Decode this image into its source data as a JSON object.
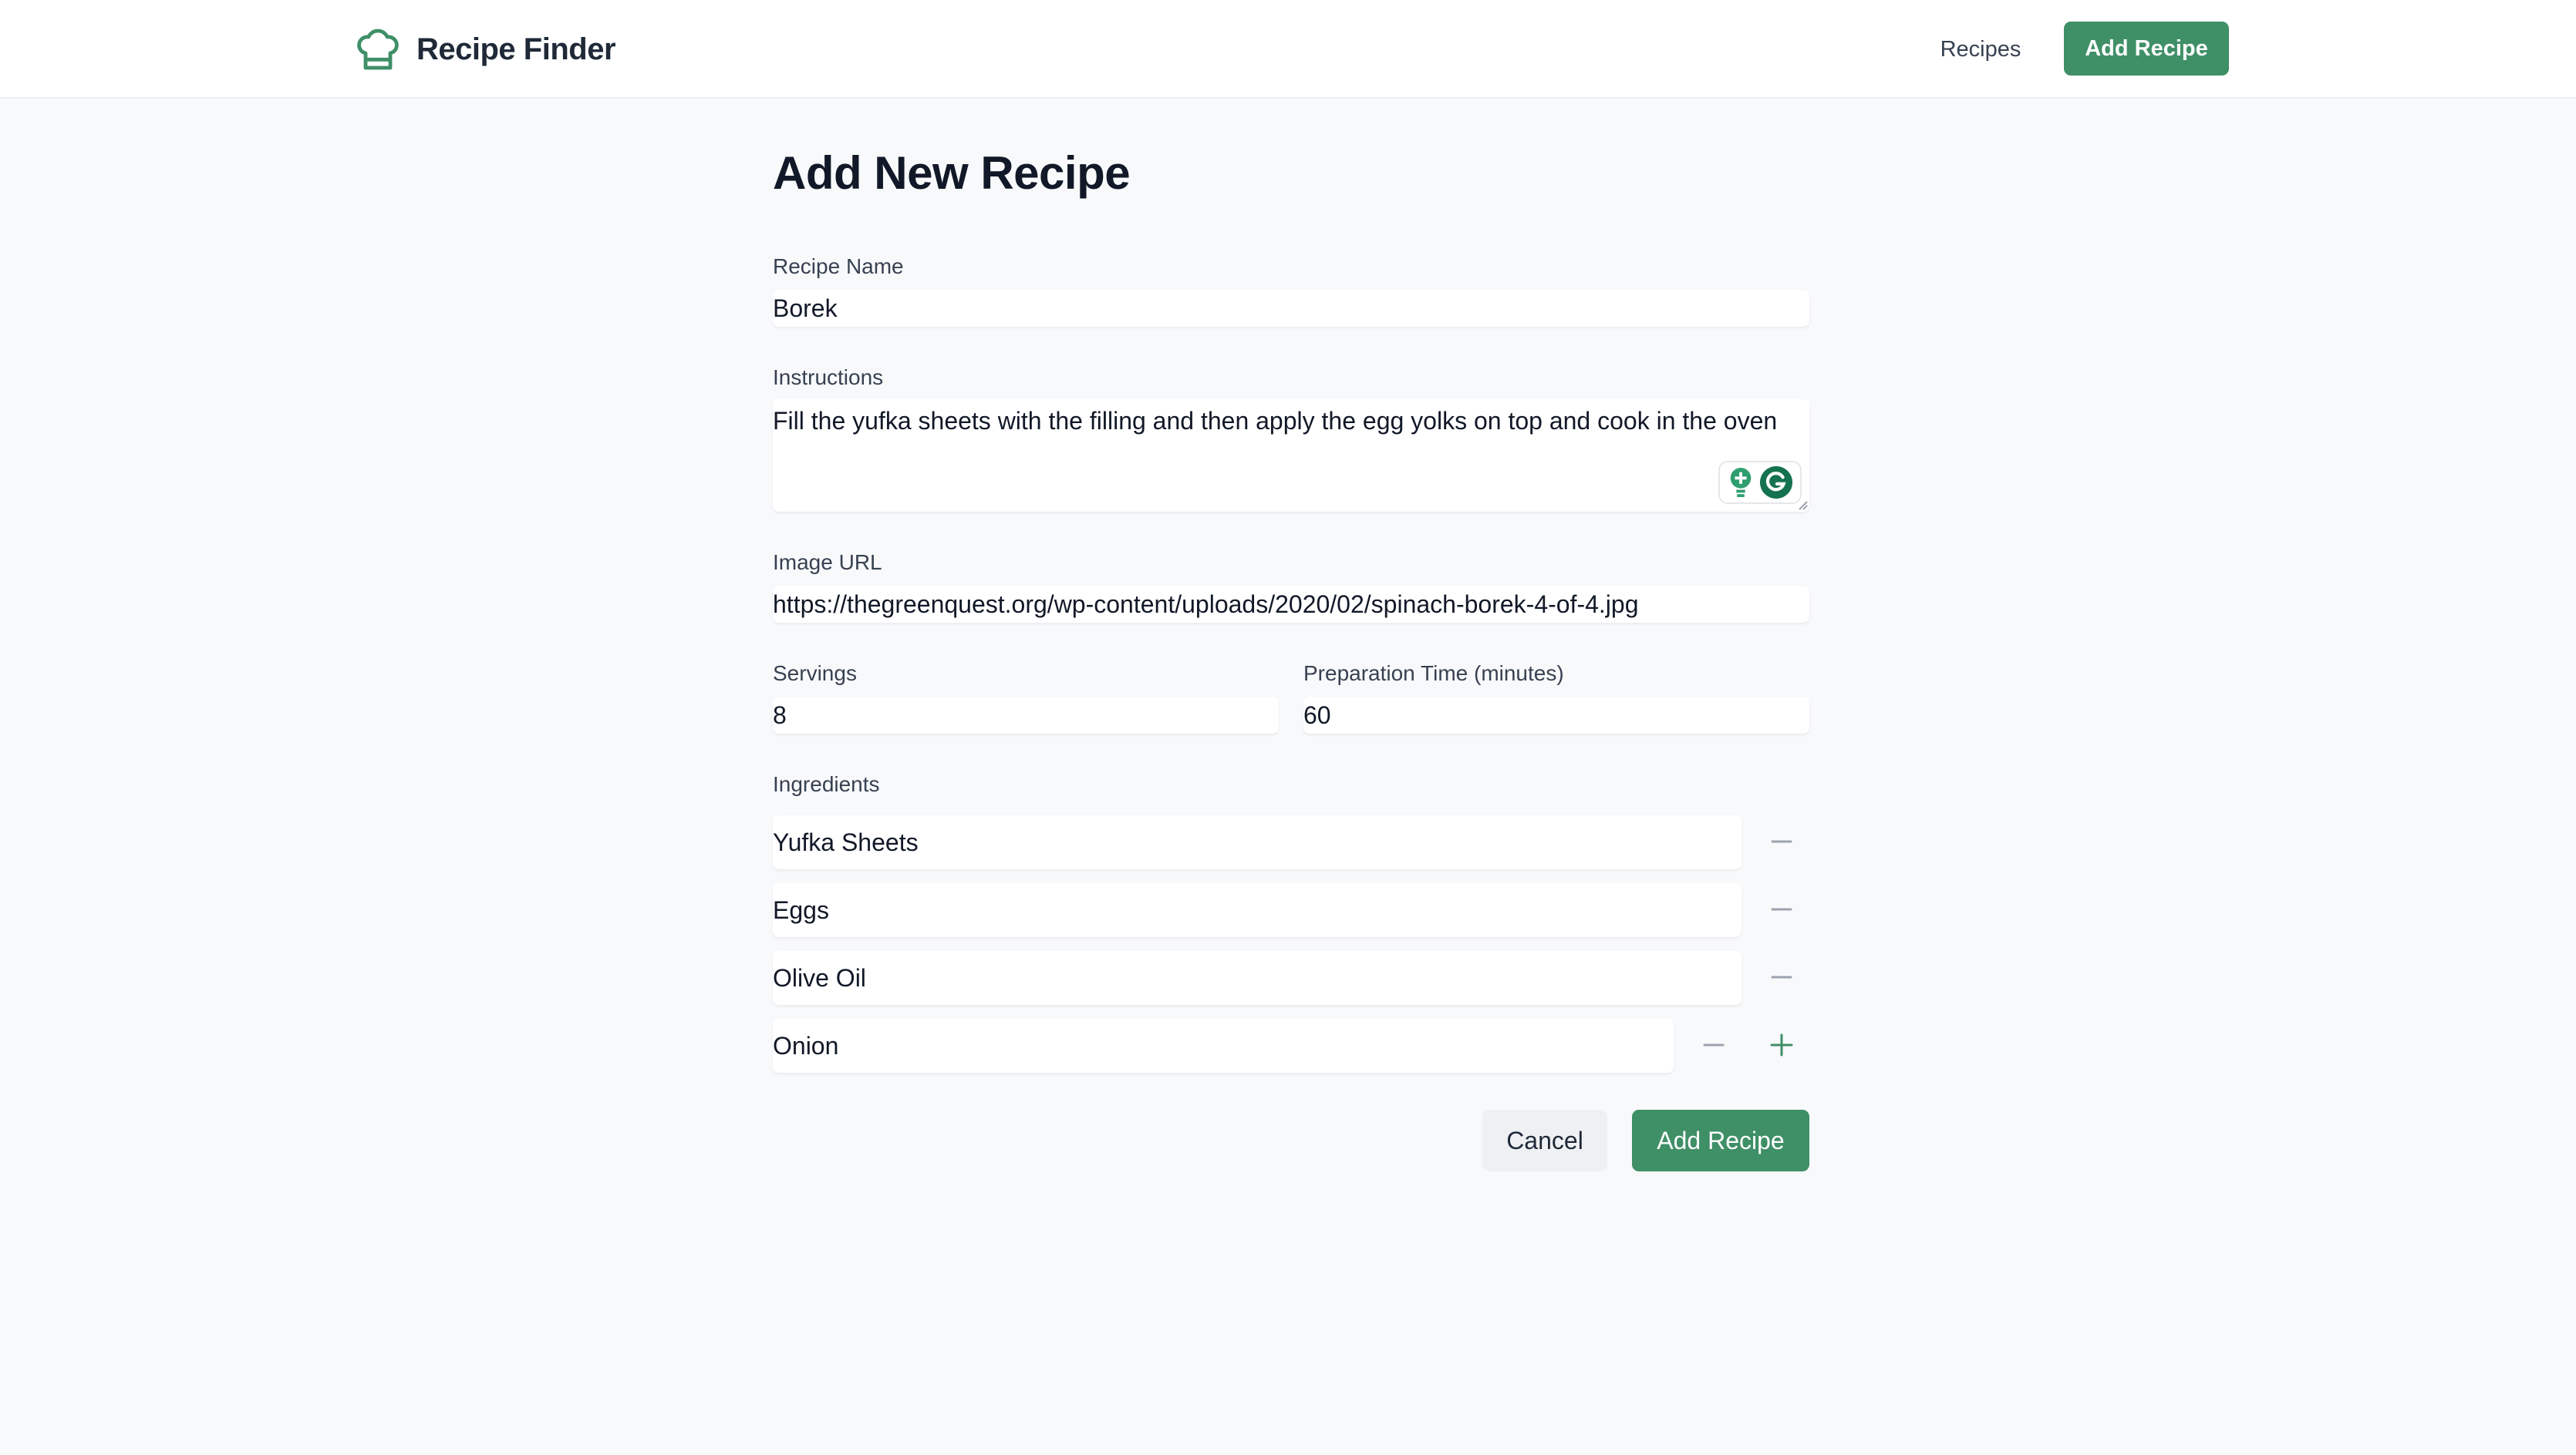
{
  "header": {
    "app_title": "Recipe Finder",
    "brand_icon": "chef-hat-icon",
    "nav_recipes": "Recipes",
    "nav_add_recipe": "Add Recipe"
  },
  "form": {
    "page_title": "Add New Recipe",
    "recipe_name": {
      "label": "Recipe Name",
      "value": "Borek"
    },
    "instructions": {
      "label": "Instructions",
      "value": "Fill the yufka sheets with the filling and then apply the egg yolks on top and cook in the oven"
    },
    "image_url": {
      "label": "Image URL",
      "value": "https://thegreenquest.org/wp-content/uploads/2020/02/spinach-borek-4-of-4.jpg"
    },
    "servings": {
      "label": "Servings",
      "value": "8"
    },
    "prep_time": {
      "label": "Preparation Time (minutes)",
      "value": "60"
    },
    "ingredients": {
      "label": "Ingredients",
      "items": [
        "Yufka Sheets",
        "Eggs",
        "Olive Oil",
        "Onion"
      ]
    },
    "cancel_label": "Cancel",
    "submit_label": "Add Recipe"
  },
  "colors": {
    "accent": "#3f8f67",
    "background": "#f8f9fb"
  }
}
